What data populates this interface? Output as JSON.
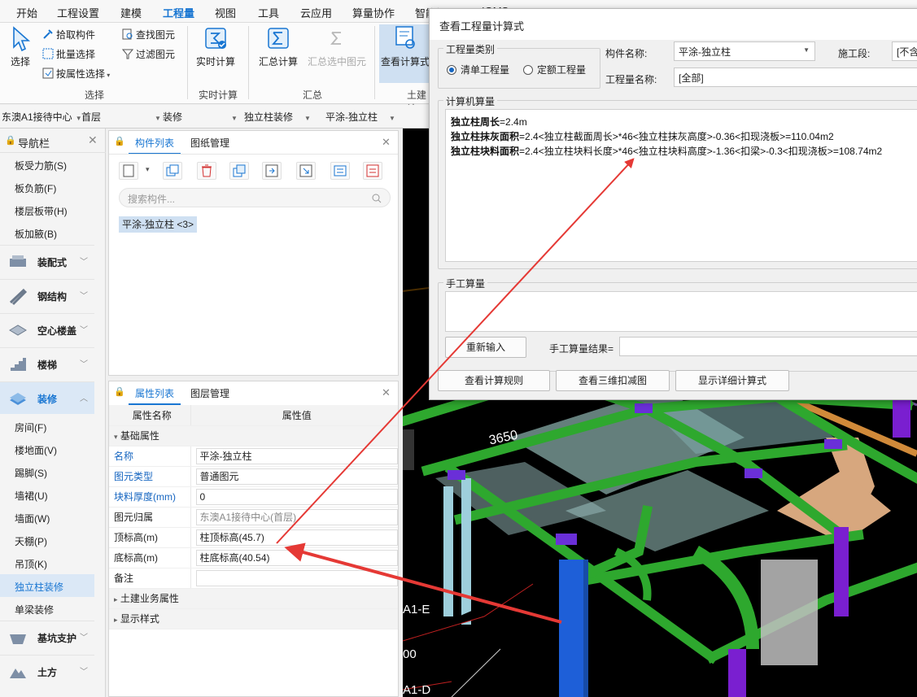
{
  "menubar": {
    "items": [
      "开始",
      "工程设置",
      "建模",
      "工程量",
      "视图",
      "工具",
      "云应用",
      "算量协作",
      "智能提量",
      "IGMS"
    ],
    "active_index": 3
  },
  "ribbon": {
    "select": "选择",
    "pick_component": "拾取构件",
    "batch_select": "批量选择",
    "attr_select": "按属性选择",
    "find_element": "查找图元",
    "filter_element": "过滤图元",
    "group_select": "选择",
    "realtime_calc": "实时计算",
    "group_realtime": "实时计算",
    "summary_calc": "汇总计算",
    "summary_selected": "汇总选中图元",
    "group_summary": "汇总",
    "view_formula": "查看计算式",
    "group_civil": "土建计"
  },
  "selectors": [
    "东澳A1接待中心",
    "首层",
    "装修",
    "独立柱装修",
    "平涂-独立柱"
  ],
  "nav": {
    "title": "导航栏",
    "top_items": [
      "板受力筋(S)",
      "板负筋(F)",
      "楼层板带(H)",
      "板加腋(B)"
    ],
    "categories": [
      {
        "label": "装配式"
      },
      {
        "label": "钢结构"
      },
      {
        "label": "空心楼盖"
      },
      {
        "label": "楼梯"
      },
      {
        "label": "装修"
      }
    ],
    "sub_items": [
      "房间(F)",
      "楼地面(V)",
      "踢脚(S)",
      "墙裙(U)",
      "墙面(W)",
      "天棚(P)",
      "吊顶(K)",
      "独立柱装修",
      "单梁装修"
    ],
    "active_sub": "独立柱装修",
    "bottom_categories": [
      {
        "label": "基坑支护"
      },
      {
        "label": "土方"
      }
    ]
  },
  "component_panel": {
    "tab_active": "构件列表",
    "tab_other": "图纸管理",
    "search_placeholder": "搜索构件...",
    "item": "平涂-独立柱 <3>"
  },
  "attr_panel": {
    "tab_active": "属性列表",
    "tab_other": "图层管理",
    "col_name": "属性名称",
    "col_value": "属性值",
    "section_basic": "基础属性",
    "rows": [
      {
        "name": "名称",
        "value": "平涂-独立柱"
      },
      {
        "name": "图元类型",
        "value": "普通图元"
      },
      {
        "name": "块料厚度(mm)",
        "value": "0"
      },
      {
        "name": "图元归属",
        "value": "东澳A1接待中心(首层)"
      },
      {
        "name": "顶标高(m)",
        "value": "柱顶标高(45.7)"
      },
      {
        "name": "底标高(m)",
        "value": "柱底标高(40.54)"
      },
      {
        "name": "备注",
        "value": ""
      }
    ],
    "section_civil": "土建业务属性",
    "section_display": "显示样式"
  },
  "canvas": {
    "dim_label": "3650",
    "axis_labels": [
      "A1-E",
      "00",
      "A1-D"
    ]
  },
  "dialog": {
    "title": "查看工程量计算式",
    "type_group": "工程量类别",
    "radio_list": "清单工程量",
    "radio_quota": "定额工程量",
    "component_name_label": "构件名称:",
    "component_name_value": "平涂-独立柱",
    "construction_label": "施工段:",
    "construction_value": "[不含",
    "quantity_name_label": "工程量名称:",
    "quantity_name_value": "[全部]",
    "computer_group": "计算机算量",
    "lines": [
      {
        "name": "独立柱周长",
        "expr": "=2.4m"
      },
      {
        "name": "独立柱抹灰面积",
        "expr": "=2.4<独立柱截面周长>*46<独立柱抹灰高度>-0.36<扣现浇板>=110.04m2"
      },
      {
        "name": "独立柱块料面积",
        "expr": "=2.4<独立柱块料长度>*46<独立柱块料高度>-1.36<扣梁>-0.3<扣现浇板>=108.74m2"
      }
    ],
    "manual_group": "手工算量",
    "reinput": "重新输入",
    "manual_result_label": "手工算量结果=",
    "btn_rules": "查看计算规则",
    "btn_3d": "查看三维扣减图",
    "btn_detail": "显示详细计算式"
  },
  "colors": {
    "accent": "#1976d2",
    "arrow": "#e53935",
    "beam_green": "#2ea82e"
  }
}
